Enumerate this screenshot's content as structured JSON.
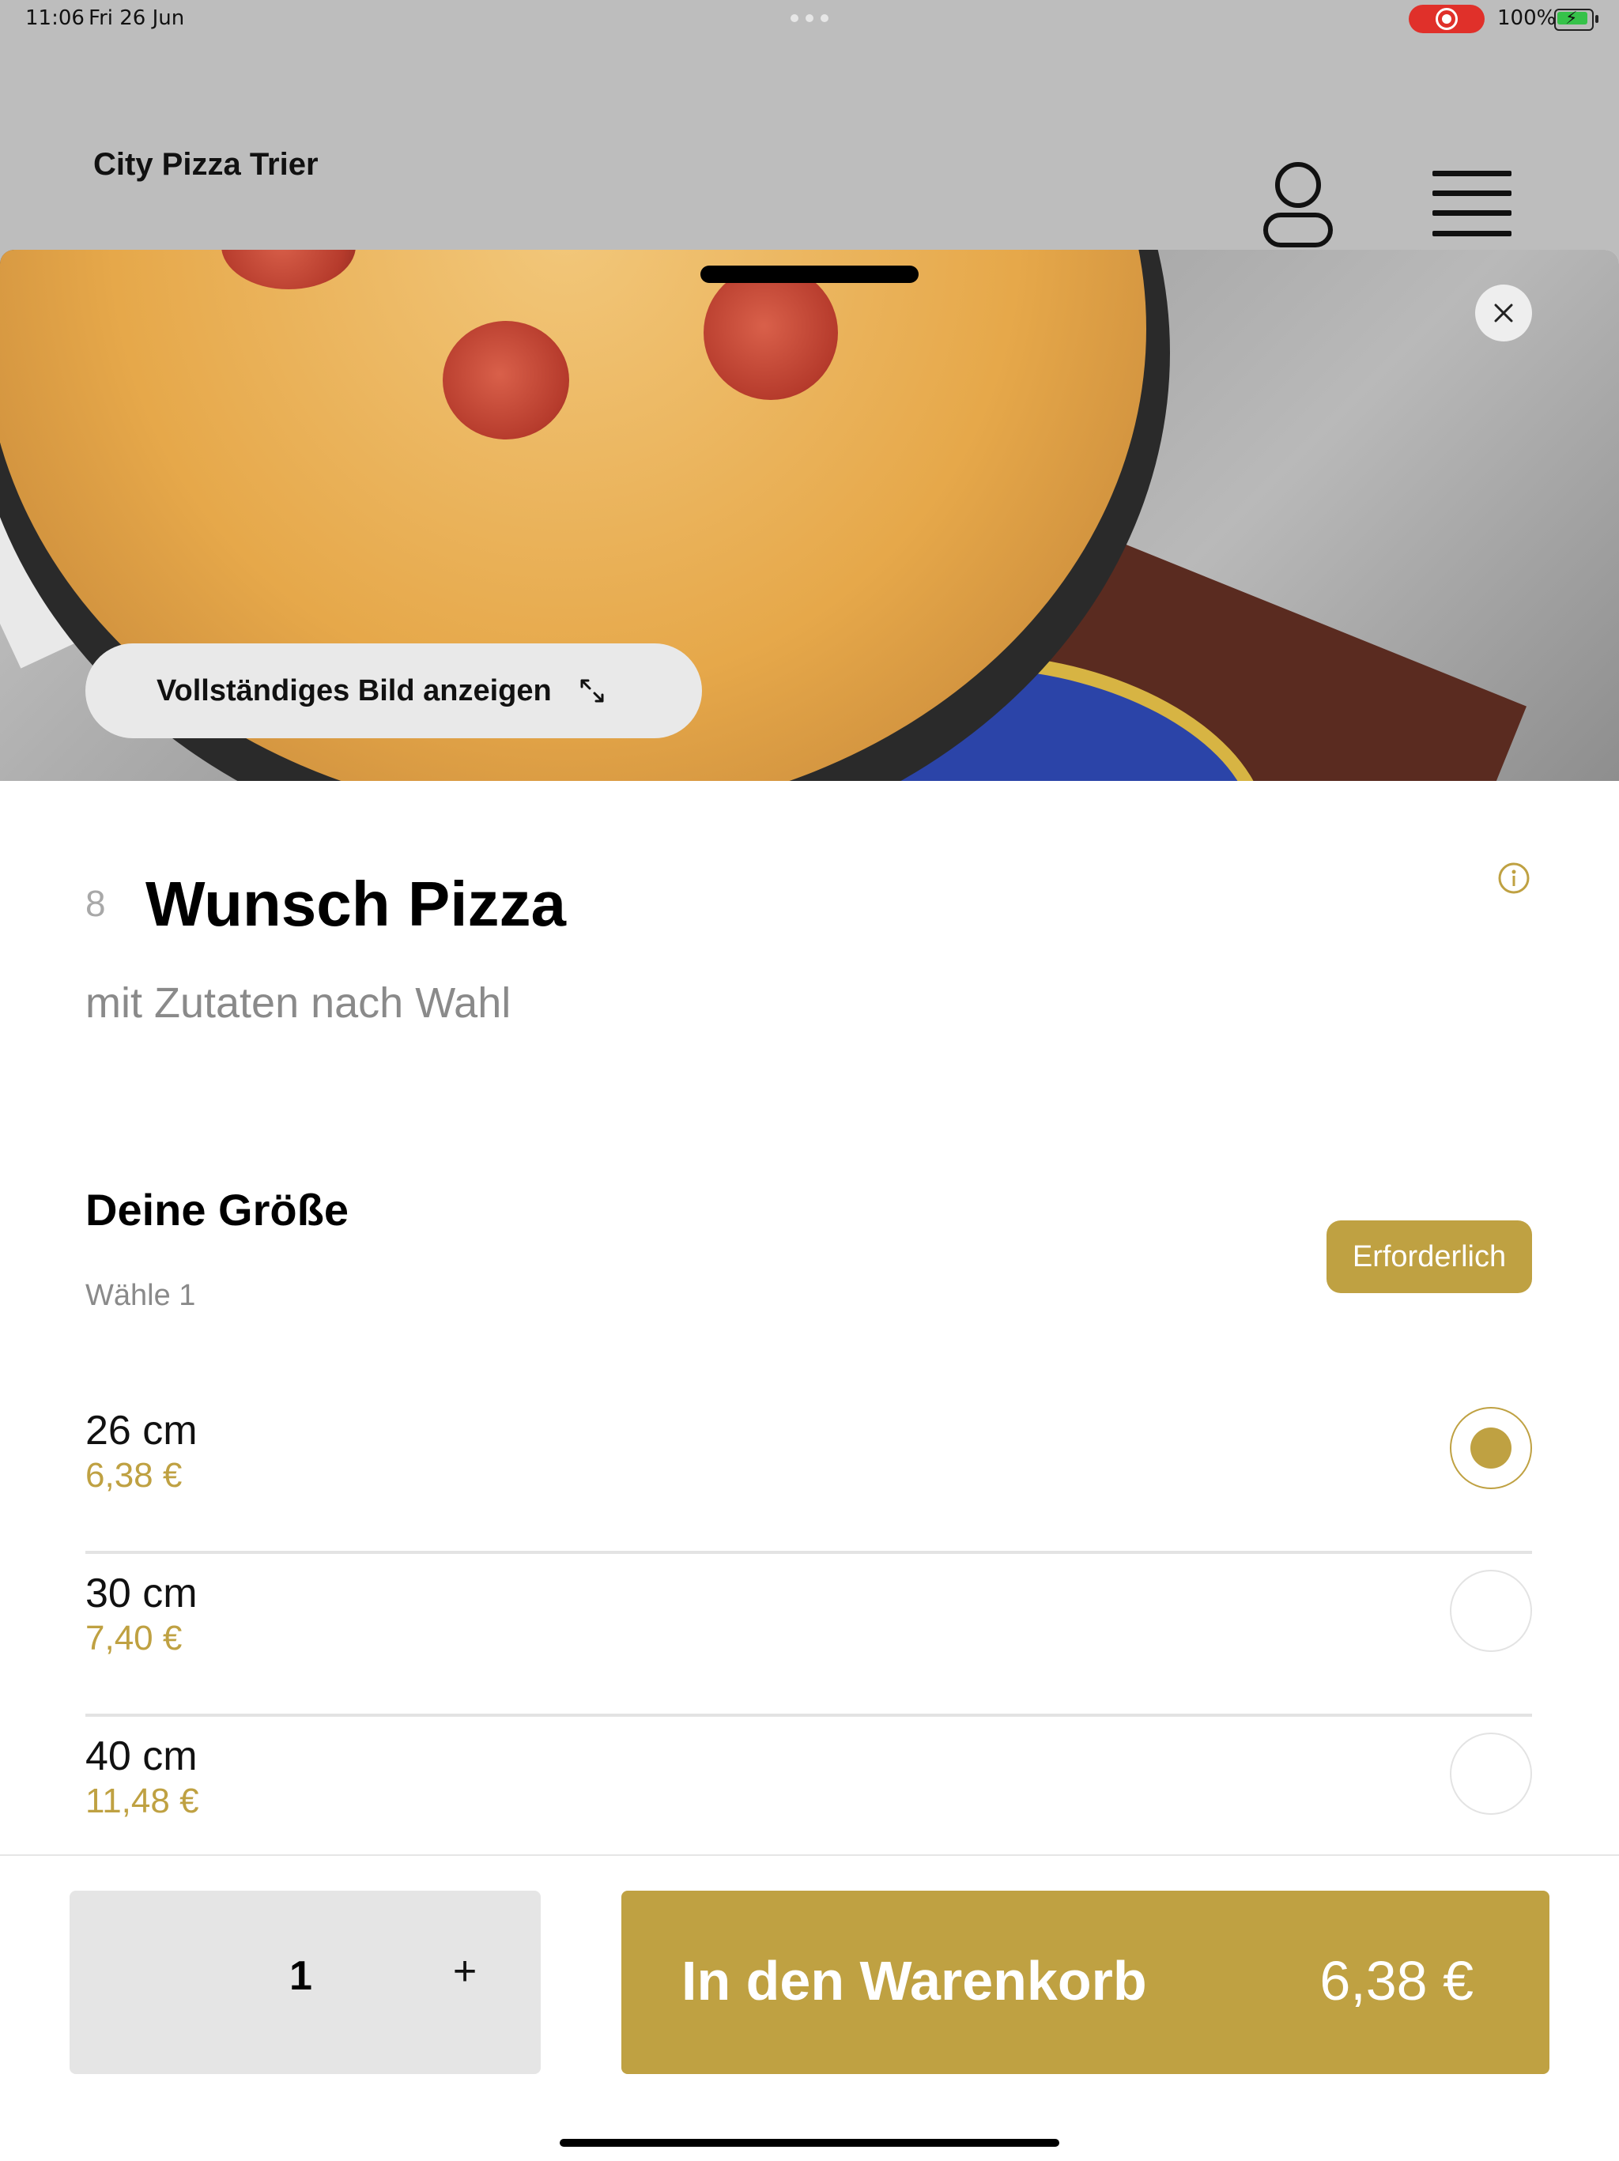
{
  "status_bar": {
    "time": "11:06",
    "date": "Fri 26 Jun",
    "battery": "100%"
  },
  "app": {
    "title": "City Pizza Trier"
  },
  "hero": {
    "view_full_image_label": "Vollständiges Bild anzeigen"
  },
  "item": {
    "number": "8",
    "title": "Wunsch Pizza",
    "description": "mit Zutaten nach Wahl"
  },
  "size_group": {
    "title": "Deine Größe",
    "subtitle": "Wähle 1",
    "required_label": "Erforderlich",
    "options": [
      {
        "size": "26 cm",
        "price": "6,38 €",
        "selected": true
      },
      {
        "size": "30 cm",
        "price": "7,40 €",
        "selected": false
      },
      {
        "size": "40 cm",
        "price": "11,48 €",
        "selected": false
      }
    ]
  },
  "footer": {
    "quantity": "1",
    "plus_label": "+",
    "add_to_cart_label": "In den Warenkorb",
    "total": "6,38 €"
  },
  "colors": {
    "accent": "#bfa142",
    "overlay": "#bdbdbd"
  }
}
